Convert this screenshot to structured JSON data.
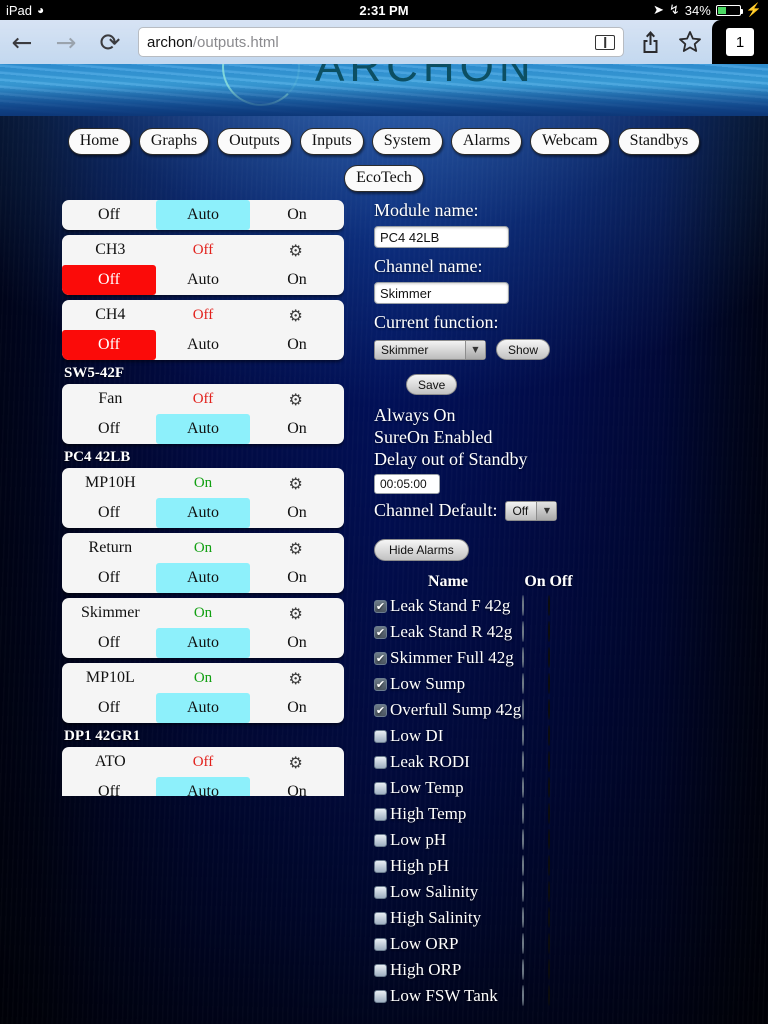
{
  "status_bar": {
    "device": "iPad",
    "wifi_icon": "wifi-icon",
    "time": "2:31 PM",
    "location_icon": "location-arrow-icon",
    "bluetooth_icon": "bluetooth-icon",
    "battery_percent": "34%",
    "charging_icon": "lightning-bolt-icon"
  },
  "browser": {
    "back_icon": "back-arrow-icon",
    "forward_icon": "forward-arrow-icon",
    "reload_icon": "reload-icon",
    "url_host": "archon",
    "url_path": "/outputs.html",
    "reader_icon": "reader-view-icon",
    "share_icon": "share-icon",
    "bookmark_icon": "bookmark-star-icon",
    "tab_count": "1"
  },
  "banner": {
    "logo_text": "ARCHON"
  },
  "nav": {
    "row1": [
      "Home",
      "Graphs",
      "Outputs",
      "Inputs",
      "System",
      "Alarms",
      "Webcam",
      "Standbys"
    ],
    "row2": [
      "EcoTech"
    ]
  },
  "channels": {
    "button_labels": {
      "off": "Off",
      "auto": "Auto",
      "on": "On"
    },
    "gear_icon": "gear-icon",
    "items": [
      {
        "kind": "channel",
        "partial_top": true,
        "name": "",
        "state": "",
        "selected": "auto"
      },
      {
        "kind": "channel",
        "name": "CH3",
        "state": "Off",
        "state_class": "off",
        "selected": "off"
      },
      {
        "kind": "channel",
        "name": "CH4",
        "state": "Off",
        "state_class": "off",
        "selected": "off"
      },
      {
        "kind": "group",
        "label": "SW5-42F"
      },
      {
        "kind": "channel",
        "name": "Fan",
        "state": "Off",
        "state_class": "off",
        "selected": "auto"
      },
      {
        "kind": "group",
        "label": "PC4 42LB"
      },
      {
        "kind": "channel",
        "name": "MP10H",
        "state": "On",
        "state_class": "on",
        "selected": "auto"
      },
      {
        "kind": "channel",
        "name": "Return",
        "state": "On",
        "state_class": "on",
        "selected": "auto"
      },
      {
        "kind": "channel",
        "name": "Skimmer",
        "state": "On",
        "state_class": "on",
        "selected": "auto"
      },
      {
        "kind": "channel",
        "name": "MP10L",
        "state": "On",
        "state_class": "on",
        "selected": "auto"
      },
      {
        "kind": "group",
        "label": "DP1 42GR1"
      },
      {
        "kind": "channel",
        "name": "ATO",
        "state": "Off",
        "state_class": "off",
        "selected": "auto"
      }
    ]
  },
  "details": {
    "module_name_label": "Module name:",
    "module_name_value": "PC4 42LB",
    "channel_name_label": "Channel name:",
    "channel_name_value": "Skimmer",
    "current_function_label": "Current function:",
    "current_function_value": "Skimmer",
    "show_button": "Show",
    "save_button": "Save",
    "always_on": "Always On",
    "sure_on": "SureOn Enabled",
    "delay_label": "Delay out of Standby",
    "delay_value": "00:05:00",
    "channel_default_label": "Channel Default:",
    "channel_default_value": "Off",
    "hide_alarms_button": "Hide Alarms"
  },
  "alarms": {
    "header": {
      "name": "Name",
      "on": "On",
      "off": "Off"
    },
    "rows": [
      {
        "name": "Leak Stand F 42g",
        "checked": true,
        "selected": "off"
      },
      {
        "name": "Leak Stand R 42g",
        "checked": true,
        "selected": "off"
      },
      {
        "name": "Skimmer Full 42g",
        "checked": true,
        "selected": "off"
      },
      {
        "name": "Low Sump",
        "checked": true,
        "selected": "off"
      },
      {
        "name": "Overfull Sump 42g",
        "checked": true,
        "selected": "off"
      },
      {
        "name": "Low DI",
        "checked": false,
        "selected": "off"
      },
      {
        "name": "Leak RODI",
        "checked": false,
        "selected": "off"
      },
      {
        "name": "Low Temp",
        "checked": false,
        "selected": "off"
      },
      {
        "name": "High Temp",
        "checked": false,
        "selected": "off"
      },
      {
        "name": "Low pH",
        "checked": false,
        "selected": "off"
      },
      {
        "name": "High pH",
        "checked": false,
        "selected": "off"
      },
      {
        "name": "Low Salinity",
        "checked": false,
        "selected": "off"
      },
      {
        "name": "High Salinity",
        "checked": false,
        "selected": "off"
      },
      {
        "name": "Low ORP",
        "checked": false,
        "selected": "off"
      },
      {
        "name": "High ORP",
        "checked": false,
        "selected": "off"
      },
      {
        "name": "Low FSW Tank",
        "checked": false,
        "selected": "off"
      }
    ]
  },
  "colors": {
    "selected_auto": "#8df0fb",
    "selected_off": "#fb0b09",
    "state_on": "#12a012",
    "state_off": "#e2211c",
    "page_blue": "#1449a6"
  }
}
